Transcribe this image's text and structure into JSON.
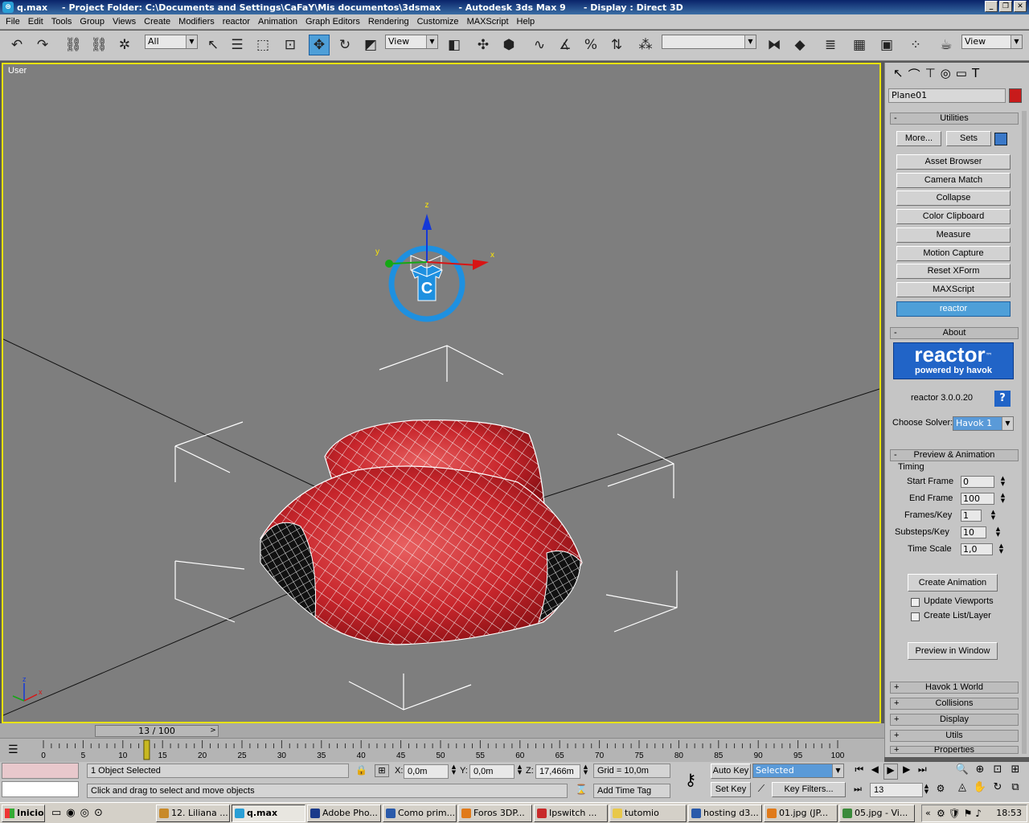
{
  "window": {
    "file": "q.max",
    "project": "- Project Folder: C:\\Documents and Settings\\CaFaY\\Mis documentos\\3dsmax",
    "app": "- Autodesk 3ds Max 9",
    "display": "- Display : Direct 3D"
  },
  "menu": [
    "File",
    "Edit",
    "Tools",
    "Group",
    "Views",
    "Create",
    "Modifiers",
    "reactor",
    "Animation",
    "Graph Editors",
    "Rendering",
    "Customize",
    "MAXScript",
    "Help"
  ],
  "toolbar": {
    "selection_filter": "All",
    "ref_coord": "View",
    "named_selection": "",
    "view_right": "View"
  },
  "viewport": {
    "label": "User",
    "axis_z": "z",
    "axis_x": "x",
    "axis_y": "y",
    "gizmo_letter": "C",
    "corner_z": "z",
    "corner_x": "x",
    "mesh_color": "#c8262c",
    "gizmo_color": "#1e90e0"
  },
  "command_panel": {
    "object_name": "Plane01",
    "object_color": "#c81b1b",
    "utilities": {
      "title": "Utilities",
      "more": "More...",
      "sets": "Sets",
      "buttons": [
        "Asset Browser",
        "Camera Match",
        "Collapse",
        "Color Clipboard",
        "Measure",
        "Motion Capture",
        "Reset XForm",
        "MAXScript",
        "reactor"
      ],
      "selected": "reactor"
    },
    "about": {
      "title": "About",
      "logo_big": "reactor",
      "logo_tm": "™",
      "logo_small": "powered by havok",
      "version": "reactor 3.0.0.20",
      "help": "?",
      "solver_label": "Choose Solver:",
      "solver": "Havok 1"
    },
    "preview": {
      "title": "Preview & Animation",
      "timing_label": "Timing",
      "fields": [
        {
          "label": "Start Frame",
          "value": "0"
        },
        {
          "label": "End Frame",
          "value": "100"
        },
        {
          "label": "Frames/Key",
          "value": "1"
        },
        {
          "label": "Substeps/Key",
          "value": "10"
        },
        {
          "label": "Time Scale",
          "value": "1,0"
        }
      ],
      "create_animation": "Create Animation",
      "update_viewports": "Update Viewports",
      "create_list_layer": "Create List/Layer",
      "preview_in_window": "Preview in Window"
    },
    "collapsed": [
      "Havok 1 World",
      "Collisions",
      "Display",
      "Utils",
      "Properties"
    ]
  },
  "timeline": {
    "slider": "13 / 100",
    "current_frame": 13,
    "ticks": [
      "0",
      "5",
      "10",
      "15",
      "20",
      "25",
      "30",
      "35",
      "40",
      "45",
      "50",
      "55",
      "60",
      "65",
      "70",
      "75",
      "80",
      "85",
      "90",
      "95",
      "100"
    ]
  },
  "status": {
    "selected": "1 Object Selected",
    "prompt": "Click and drag to select and move objects",
    "x_label": "X:",
    "x": "0,0m",
    "y_label": "Y:",
    "y": "0,0m",
    "z_label": "Z:",
    "z": "17,466m",
    "grid": "Grid = 10,0m",
    "add_time_tag": "Add Time Tag",
    "auto_key": "Auto Key",
    "set_key": "Set Key",
    "key_mode": "Selected",
    "key_filters": "Key Filters...",
    "frame": "13"
  },
  "taskbar": {
    "start": "Inicio",
    "tasks": [
      "12. Liliana ...",
      "q.max",
      "Adobe Pho...",
      "Como prim...",
      "Foros 3DP...",
      "Ipswitch ...",
      "tutomio",
      "hosting d3...",
      "01.jpg (JP...",
      "05.jpg - Vi..."
    ],
    "active": "q.max",
    "clock": "18:53"
  }
}
